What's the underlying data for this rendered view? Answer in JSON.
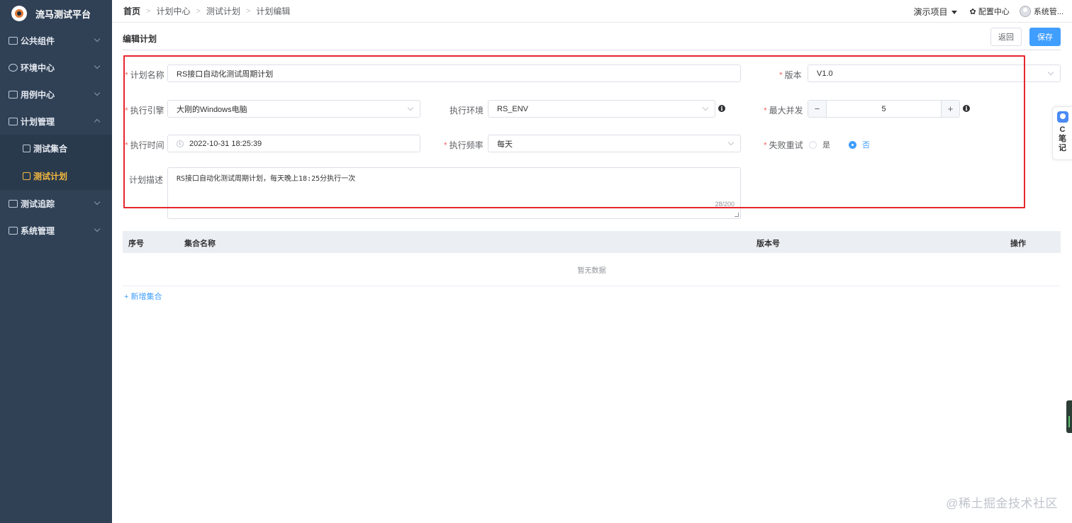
{
  "sidebar": {
    "app_name": "流马测试平台",
    "items": [
      {
        "label": "公共组件",
        "icon": "component-icon",
        "expanded": false
      },
      {
        "label": "环境中心",
        "icon": "globe-icon",
        "expanded": false
      },
      {
        "label": "用例中心",
        "icon": "case-icon",
        "expanded": false
      },
      {
        "label": "计划管理",
        "icon": "plan-icon",
        "expanded": true
      },
      {
        "label": "测试追踪",
        "icon": "trace-icon",
        "expanded": false
      },
      {
        "label": "系统管理",
        "icon": "system-icon",
        "expanded": false
      }
    ],
    "sub_items": [
      {
        "label": "测试集合",
        "icon": "collection-icon",
        "active": false
      },
      {
        "label": "测试计划",
        "icon": "test-plan-icon",
        "active": true
      }
    ],
    "active_color": "#f4b93f"
  },
  "header": {
    "breadcrumb": [
      "首页",
      "计划中心",
      "测试计划",
      "计划编辑"
    ],
    "project": "演示项目",
    "config": "配置中心",
    "user": "系统管..."
  },
  "page": {
    "title": "编辑计划",
    "back_label": "返回",
    "save_label": "保存"
  },
  "form": {
    "plan_name_label": "计划名称",
    "plan_name_value": "RS接口自动化测试周期计划",
    "version_label": "版本",
    "version_value": "V1.0",
    "engine_label": "执行引擎",
    "engine_value": "大刚的Windows电脑",
    "env_label": "执行环境",
    "env_value": "RS_ENV",
    "concurrency_label": "最大并发",
    "concurrency_value": "5",
    "concurrency_minus": "−",
    "concurrency_plus": "+",
    "time_label": "执行时间",
    "time_value": "2022-10-31 18:25:39",
    "frequency_label": "执行频率",
    "frequency_value": "每天",
    "retry_label": "失败重试",
    "retry_yes": "是",
    "retry_no": "否",
    "retry_selected": "否",
    "desc_label": "计划描述",
    "desc_value": "RS接口自动化测试周期计划，每天晚上18:25分执行一次",
    "desc_counter": "28/200",
    "info_glyph": "i"
  },
  "table": {
    "columns": [
      "序号",
      "集合名称",
      "版本号",
      "操作"
    ],
    "empty_text": "暂无数据",
    "add_label": "+ 新增集合"
  },
  "widgets": {
    "note_line1": "C",
    "note_line2": "笔",
    "note_line3": "记"
  },
  "watermark": "@稀土掘金技术社区",
  "colors": {
    "primary": "#409eff",
    "sidebar_bg": "#304156",
    "highlight_border": "#e5262d",
    "required": "#f56c6c"
  }
}
